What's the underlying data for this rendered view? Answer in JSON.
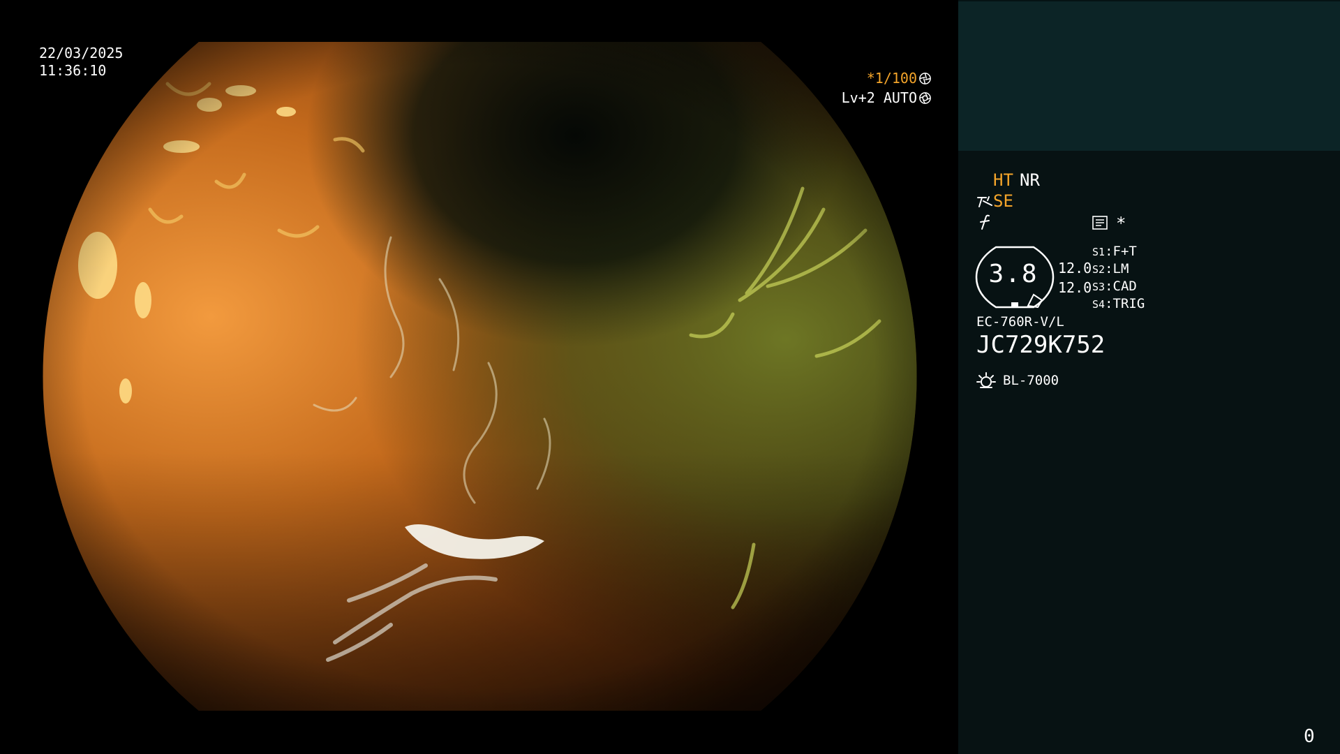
{
  "overlay": {
    "date": "22/03/2025",
    "time": "11:36:10",
    "shutter": "*1/100",
    "light_level": "Lv+2",
    "iris_mode": "AUTO"
  },
  "icons": {
    "shutter": "shutter-icon",
    "iris": "iris-icon",
    "se": "se-icon",
    "f": "f-icon",
    "memo": "memo-icon",
    "light": "light-source-icon"
  },
  "panel": {
    "ht": "HT",
    "nr": "NR",
    "se": "SE",
    "star": "*",
    "zoom": "3.8",
    "stat_a": "12.0",
    "stat_b": "12.0",
    "switches": [
      {
        "key": "S1",
        "value": "F+T"
      },
      {
        "key": "S2",
        "value": "LM"
      },
      {
        "key": "S3",
        "value": "CAD"
      },
      {
        "key": "S4",
        "value": "TRIG"
      }
    ],
    "scope_model": "EC-760R-V/L",
    "scope_serial": "JC729K752",
    "light_source": "BL-7000",
    "counter": "0"
  },
  "colors": {
    "highlight": "#f5a52a",
    "panel_top": "#0c2426",
    "panel_body": "#071213",
    "text": "#ffffff"
  }
}
